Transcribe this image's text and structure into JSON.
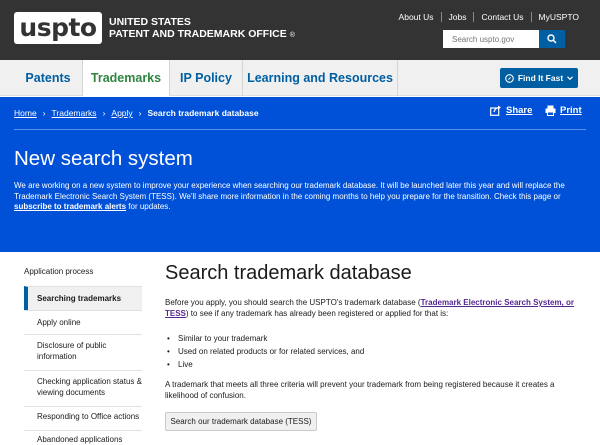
{
  "header": {
    "logo_text": "uspto",
    "agency_line1": "UNITED STATES",
    "agency_line2": "PATENT AND TRADEMARK OFFICE",
    "reg_mark": "®",
    "top_links": [
      "About Us",
      "Jobs",
      "Contact Us",
      "MyUSPTO"
    ],
    "search_placeholder": "Search uspto.gov",
    "search_icon": "search-icon"
  },
  "nav": {
    "items": [
      "Patents",
      "Trademarks",
      "IP Policy",
      "Learning and Resources"
    ],
    "active": "Trademarks",
    "find_button": "Find It Fast",
    "find_icon": "compass-icon"
  },
  "hero": {
    "breadcrumb": [
      "Home",
      "Trademarks",
      "Apply"
    ],
    "breadcrumb_current": "Search trademark database",
    "share_label": "Share",
    "print_label": "Print",
    "title": "New search system",
    "text_before_link": "We are working on a new system to improve your experience when searching our trademark database. It will be launched later this year and will replace the Trademark Electronic Search System (TESS). We'll share more information in the coming months to help you prepare for the transition. Check this page or",
    "link_text": "subscribe to trademark alerts",
    "text_after_link": "for updates."
  },
  "sidebar": {
    "heading": "Application process",
    "items": [
      "Searching trademarks",
      "Apply online",
      "Disclosure of public information",
      "Checking application status & viewing documents",
      "Responding to Office actions",
      "Abandoned applications"
    ],
    "active_index": 0
  },
  "main": {
    "title": "Search trademark database",
    "intro_before": "Before you apply, you should search the USPTO's trademark database (",
    "intro_link": "Trademark Electronic Search System, or TESS",
    "intro_after": ") to see if any trademark has already been registered or applied for that is:",
    "bullets": [
      "Similar to your trademark",
      "Used on related products or for related services, and",
      "Live"
    ],
    "note": "A trademark that meets all three criteria will prevent your trademark from being registered because it creates a likelihood of confusion.",
    "button_label": "Search our trademark database (TESS)"
  },
  "colors": {
    "header_bg": "#333333",
    "hero_bg": "#0050d8",
    "link_blue": "#005ea2",
    "active_nav": "#2e8540",
    "visited_link": "#54278f"
  }
}
